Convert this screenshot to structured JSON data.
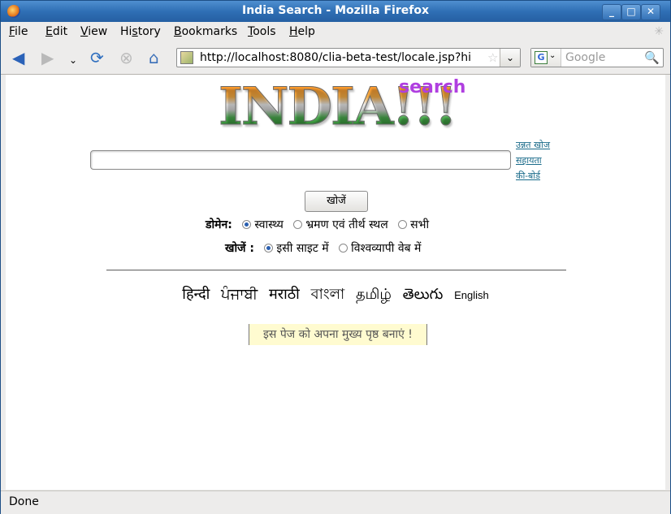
{
  "window": {
    "title": "India Search - Mozilla Firefox"
  },
  "menubar": {
    "items": [
      {
        "label": "File",
        "accel": "F",
        "rest": "ile"
      },
      {
        "label": "Edit",
        "accel": "E",
        "rest": "dit"
      },
      {
        "label": "View",
        "accel": "V",
        "rest": "iew"
      },
      {
        "label": "History",
        "pre": "Hi",
        "accel": "s",
        "rest": "tory"
      },
      {
        "label": "Bookmarks",
        "accel": "B",
        "rest": "ookmarks"
      },
      {
        "label": "Tools",
        "accel": "T",
        "rest": "ools"
      },
      {
        "label": "Help",
        "accel": "H",
        "rest": "elp"
      }
    ]
  },
  "navbar": {
    "url": "http://localhost:8080/clia-beta-test/locale.jsp?hi",
    "search_placeholder": "Google"
  },
  "page": {
    "logo_text": "INDIA!!!",
    "logo_sub": "search",
    "side_links": [
      "उन्नत खोज",
      "सहायता",
      "की-बोर्ड"
    ],
    "search_button": "खोजें",
    "domain_label": "डोमेन:",
    "domain_options": [
      "स्वास्थ्य",
      "भ्रमण एवं तीर्थ स्थल",
      "सभी"
    ],
    "scope_label": "खोजें :",
    "scope_options": [
      "इसी साइट में",
      "विश्वव्यापी वेब में"
    ],
    "languages": [
      "हिन्दी",
      "ਪੰਜਾਬੀ",
      "मराठी",
      "বাংলা",
      "தமிழ்",
      "తెలుగు",
      "English"
    ],
    "homepage_text": "इस पेज को अपना मुख्य पृष्ठ बनाएं !"
  },
  "status": {
    "text": "Done"
  }
}
